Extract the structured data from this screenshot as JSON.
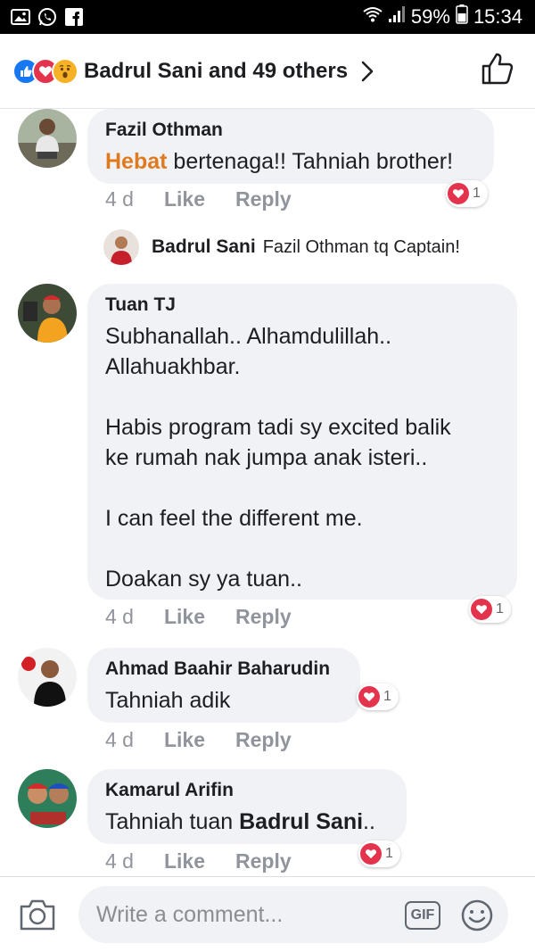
{
  "status_bar": {
    "battery": "59%",
    "time": "15:34"
  },
  "header": {
    "title": "Badrul Sani and 49 others"
  },
  "comments": [
    {
      "author": "Fazil Othman",
      "highlight": "Hebat",
      "text": " bertenaga!! Tahniah brother!",
      "time": "4 d",
      "like": "Like",
      "reply": "Reply",
      "reaction_count": "1",
      "reply_item": {
        "author": "Badrul Sani",
        "text": "Fazil Othman tq Captain!"
      }
    },
    {
      "author": "Tuan TJ",
      "text": "Subhanallah.. Alhamdulillah..\nAllahuakhbar.\n\nHabis program tadi sy excited balik\nke rumah nak jumpa anak isteri..\n\nI can feel the different me.\n\nDoakan sy ya tuan..",
      "time": "4 d",
      "like": "Like",
      "reply": "Reply",
      "reaction_count": "1"
    },
    {
      "author": "Ahmad Baahir Baharudin",
      "text": "Tahniah adik",
      "time": "4 d",
      "like": "Like",
      "reply": "Reply",
      "reaction_count": "1"
    },
    {
      "author": "Kamarul Arifin",
      "text": "Tahniah tuan ",
      "bold_text": "Badrul Sani",
      "suffix": "..",
      "time": "4 d",
      "like": "Like",
      "reply": "Reply",
      "reaction_count": "1"
    }
  ],
  "composer": {
    "placeholder": "Write a comment...",
    "gif_label": "GIF"
  },
  "colors": {
    "like_blue": "#1877f2",
    "love_red": "#e4334c",
    "bubble_bg": "#f0f2f5",
    "highlight": "#e07a1f"
  },
  "icons": [
    "image-icon",
    "whatsapp-icon",
    "facebook-icon",
    "wifi-icon",
    "signal-icon",
    "battery-icon",
    "like-reaction-icon",
    "love-reaction-icon",
    "wow-reaction-icon",
    "chevron-right-icon",
    "thumbs-up-icon",
    "heart-icon",
    "camera-icon",
    "gif-icon",
    "smiley-icon"
  ]
}
